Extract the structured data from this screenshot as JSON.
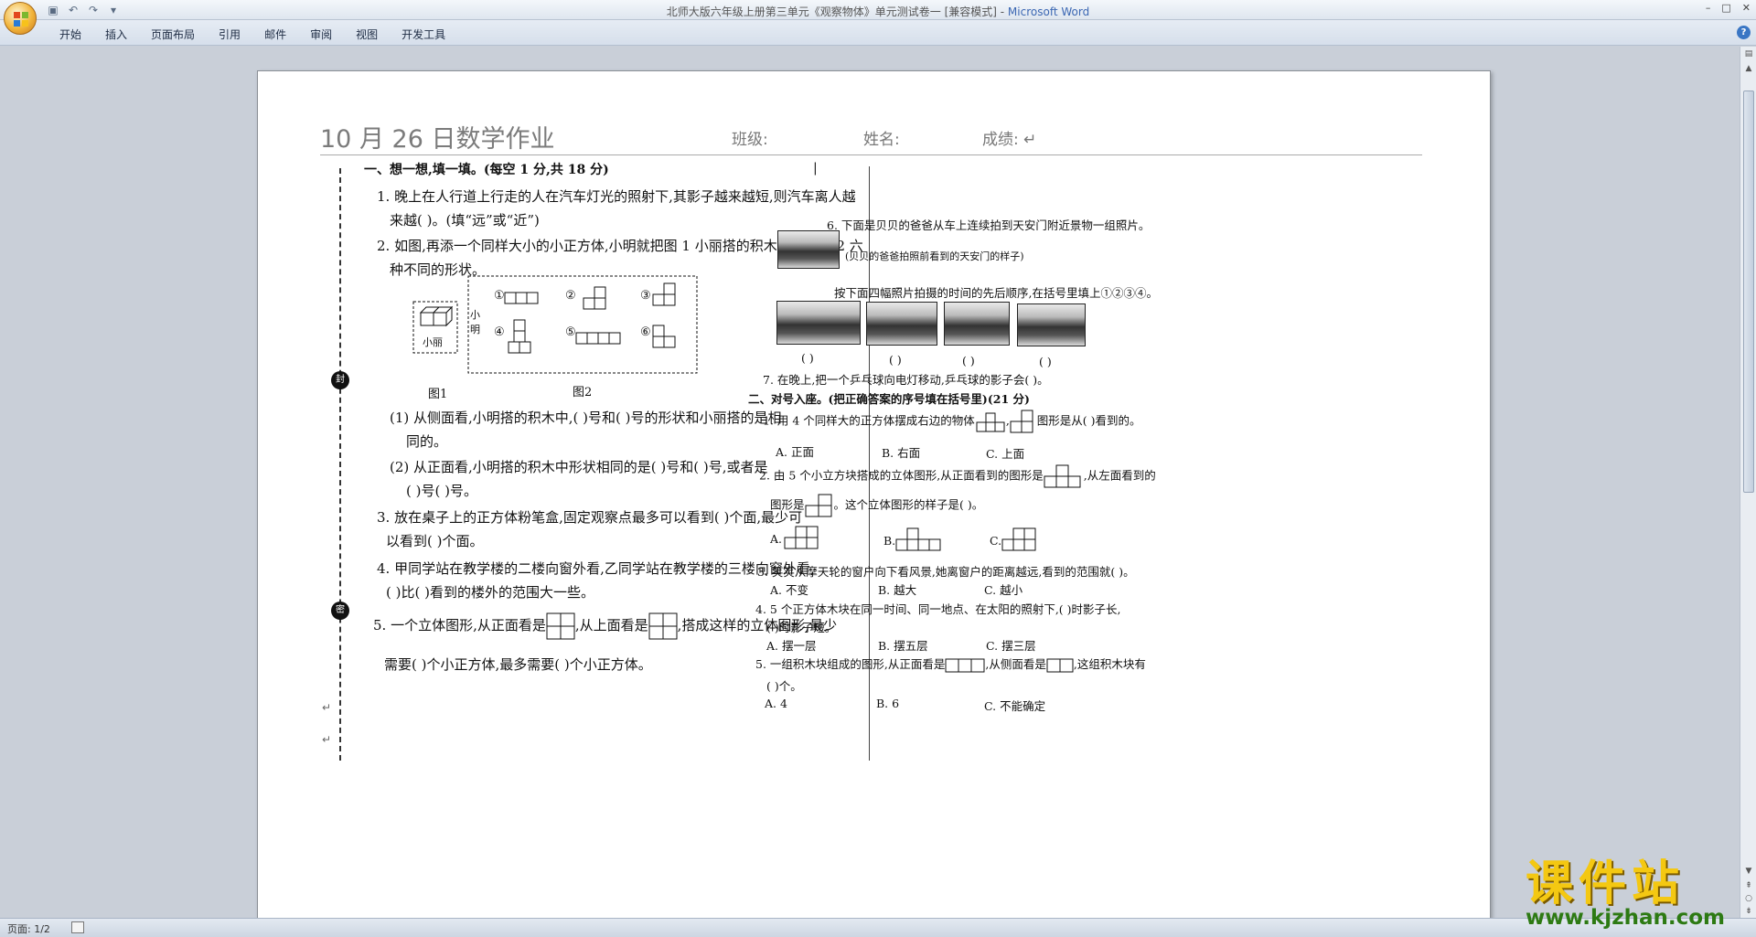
{
  "window": {
    "title_doc": "北师大版六年级上册第三单元《观察物体》单元测试卷一 [兼容模式] - ",
    "title_app": "Microsoft Word",
    "controls": [
      "–",
      "□",
      "✕"
    ]
  },
  "ribbon": {
    "tabs": [
      "开始",
      "插入",
      "页面布局",
      "引用",
      "邮件",
      "审阅",
      "视图",
      "开发工具"
    ]
  },
  "doc": {
    "title": "10 月 26 日数学作业",
    "class_label": "班级:",
    "name_label": "姓名:",
    "score_label": "成绩: ↵"
  },
  "left": {
    "sec1": "一、想一想,填一填。(每空 1 分,共 18 分)",
    "q1a": "1. 晚上在人行道上行走的人在汽车灯光的照射下,其影子越来越短,则汽车离人越",
    "q1b": "来越(      )。(填“远”或“近”)",
    "q2a": "2. 如图,再添一个同样大小的小正方体,小明就把图 1 小丽搭的积木变成了图 2 六",
    "q2b": "种不同的形状。",
    "fig_xiaoli": "小丽",
    "fig_xiaoming": "小明",
    "fig1": "图1",
    "fig2": "图2",
    "nums": [
      "①",
      "②",
      "③",
      "④",
      "⑤",
      "⑥"
    ],
    "s1a": "(1) 从侧面看,小明搭的积木中,(      )号和(      )号的形状和小丽搭的是相",
    "s1b": "同的。",
    "s2a": "(2) 从正面看,小明搭的积木中形状相同的是(      )号和(      )号,或者是",
    "s2b": "(      )号(      )号。",
    "q3a": "3. 放在桌子上的正方体粉笔盒,固定观察点最多可以看到(          )个面,最少可",
    "q3b": "以看到(          )个面。",
    "q4a": "4. 甲同学站在教学楼的二楼向窗外看,乙同学站在教学楼的三楼向窗外看,",
    "q4b": "(      )比(      )看到的楼外的范围大一些。",
    "q5a_pre": "5. 一个立体图形,从正面看是",
    "q5a_mid": ",从上面看是",
    "q5a_post": ",搭成这样的立体图形,最少",
    "q5b": "需要(      )个小正方体,最多需要(      )个小正方体。",
    "seal1": "封",
    "seal2": "密"
  },
  "right": {
    "q6": "6. 下面是贝贝的爸爸从车上连续拍到天安门附近景物一组照片。",
    "q6_caption": "(贝贝的爸爸拍照前看到的天安门的样子)",
    "q6_instr": "按下面四幅照片拍摄的时间的先后顺序,在括号里填上①②③④。",
    "q6_blanks": [
      "(      )",
      "(      )",
      "(      )",
      "(      )"
    ],
    "q7": "7. 在晚上,把一个乒乓球向电灯移动,乒乓球的影子会(      )。",
    "sec2": "二、对号入座。(把正确答案的序号填在括号里)(21 分)",
    "r1_pre": "1. 用 4 个同样大的正方体摆成右边的物体",
    "r1_post": "图形是从(      )看到的。",
    "r1_opts": [
      "A. 正面",
      "B. 右面",
      "C. 上面"
    ],
    "r2_pre": "2. 由 5 个小立方块搭成的立体图形,从正面看到的图形是",
    "r2_post": ",从左面看到的",
    "r2b_pre": "图形是",
    "r2b_post": "。这个立体图形的样子是(      )。",
    "r2_opts": [
      "A.",
      "B.",
      "C."
    ],
    "r3": "3. 笑笑从摩天轮的窗户向下看风景,她离窗户的距离越远,看到的范围就(      )。",
    "r3_opts": [
      "A. 不变",
      "B. 越大",
      "C. 越小"
    ],
    "r4a": "4. 5 个正方体木块在同一时间、同一地点、在太阳的照射下,(      )时影子长,",
    "r4b": "(      )时影子短。",
    "r4_opts": [
      "A. 摆一层",
      "B. 摆五层",
      "C. 摆三层"
    ],
    "r5_pre": "5. 一组积木块组成的图形,从正面看是",
    "r5_mid": ",从侧面看是",
    "r5_post": ",这组积木块有",
    "r5b": "(      )个。",
    "r5_opts": [
      "A. 4",
      "B. 6",
      "C. 不能确定"
    ]
  },
  "status": {
    "page": "页面: 1/2"
  },
  "watermark": {
    "cn": "课件站",
    "url": "www.kjzhan.com"
  }
}
